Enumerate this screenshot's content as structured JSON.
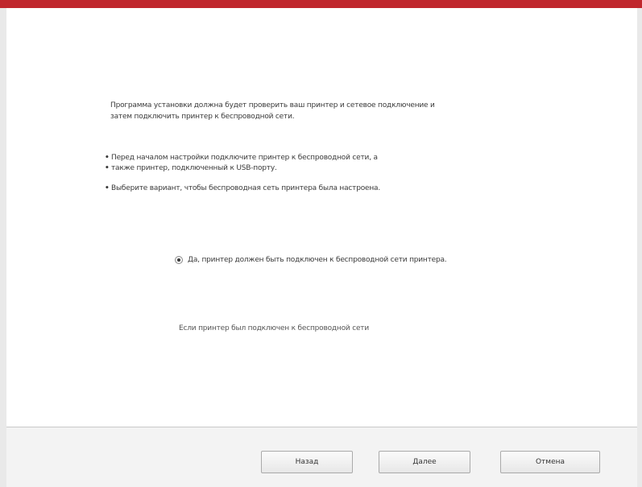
{
  "window": {
    "accent_color": "#c0272d"
  },
  "intro": {
    "line1": "Программа установки должна будет проверить ваш принтер и сетевое подключение и",
    "line2": "затем подключить принтер к беспроводной сети."
  },
  "bullets": [
    "Перед началом настройки подключите принтер к беспроводной сети, а",
    "также принтер, подключенный к USB-порту.",
    "Выберите вариант, чтобы беспроводная сеть принтера была настроена."
  ],
  "option": {
    "label": "Да, принтер должен быть подключен к беспроводной сети принтера.",
    "selected": true
  },
  "link": {
    "text": "Если принтер был подключен к беспроводной сети"
  },
  "buttons": {
    "back": "Назад",
    "next": "Далее",
    "cancel": "Отмена"
  }
}
